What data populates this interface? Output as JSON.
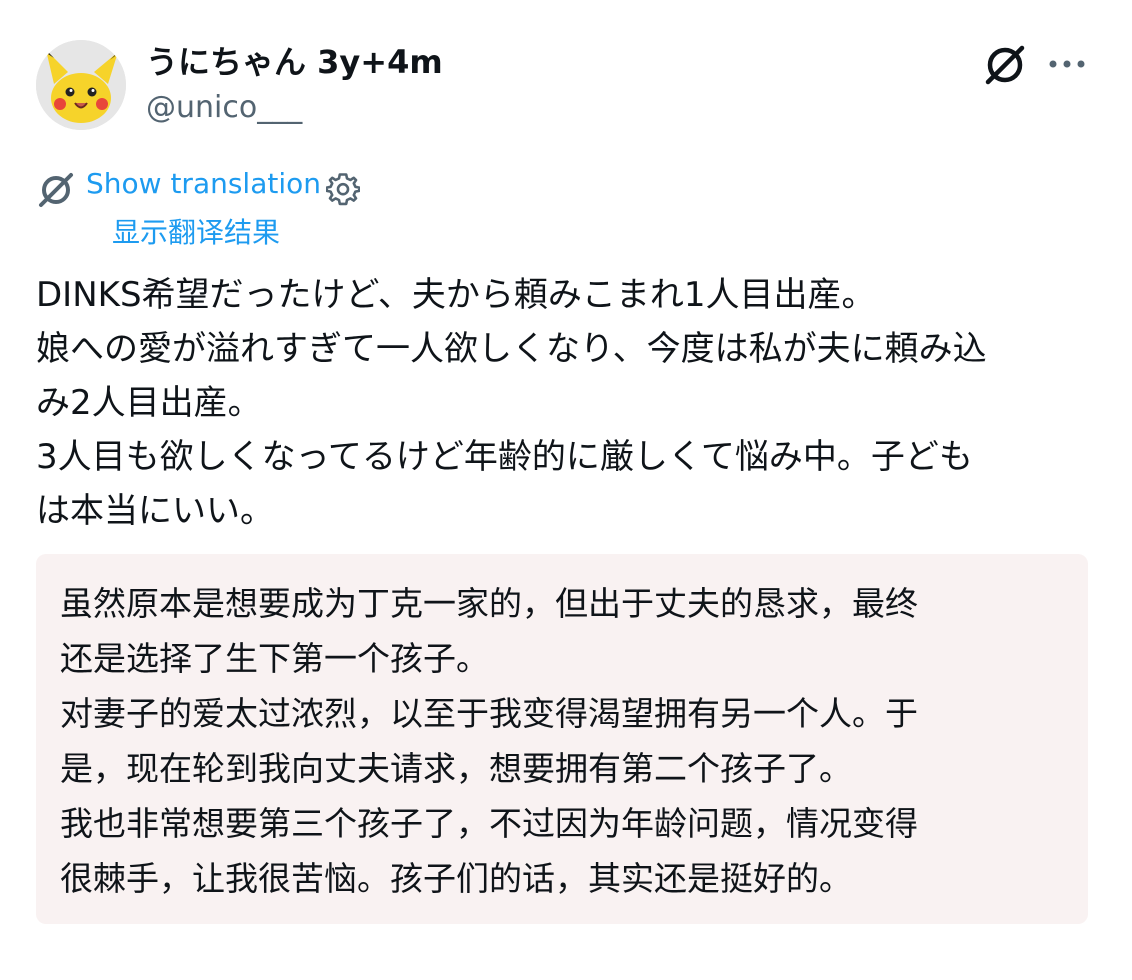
{
  "header": {
    "display_name": "うにちゃん 3y+4m",
    "handle": "@unico___"
  },
  "icons": {
    "avatar": "pikachu-avatar",
    "translate": "translate-slash-icon",
    "more": "more-dots-icon",
    "gear": "gear-icon"
  },
  "colors": {
    "link": "#1d9bf0",
    "text": "#0f1419",
    "muted": "#536471",
    "translation_bg": "#f9f2f2"
  },
  "translation": {
    "show_label": "Show translation",
    "show_label_cn": "显示翻译结果"
  },
  "tweet": {
    "lines": [
      "DINKS希望だったけど、夫から頼みこまれ1人目出産。",
      "娘への愛が溢れすぎて一人欲しくなり、今度は私が夫に頼み込",
      "み2人目出産。",
      "3人目も欲しくなってるけど年齢的に厳しくて悩み中。子ども",
      "は本当にいい。"
    ]
  },
  "translated": {
    "lines": [
      "虽然原本是想要成为丁克一家的，但出于丈夫的恳求，最终",
      "还是选择了生下第一个孩子。",
      "对妻子的爱太过浓烈，以至于我变得渴望拥有另一个人。于",
      "是，现在轮到我向丈夫请求，想要拥有第二个孩子了。",
      "我也非常想要第三个孩子了，不过因为年龄问题，情况变得",
      "很棘手，让我很苦恼。孩子们的话，其实还是挺好的。"
    ]
  }
}
